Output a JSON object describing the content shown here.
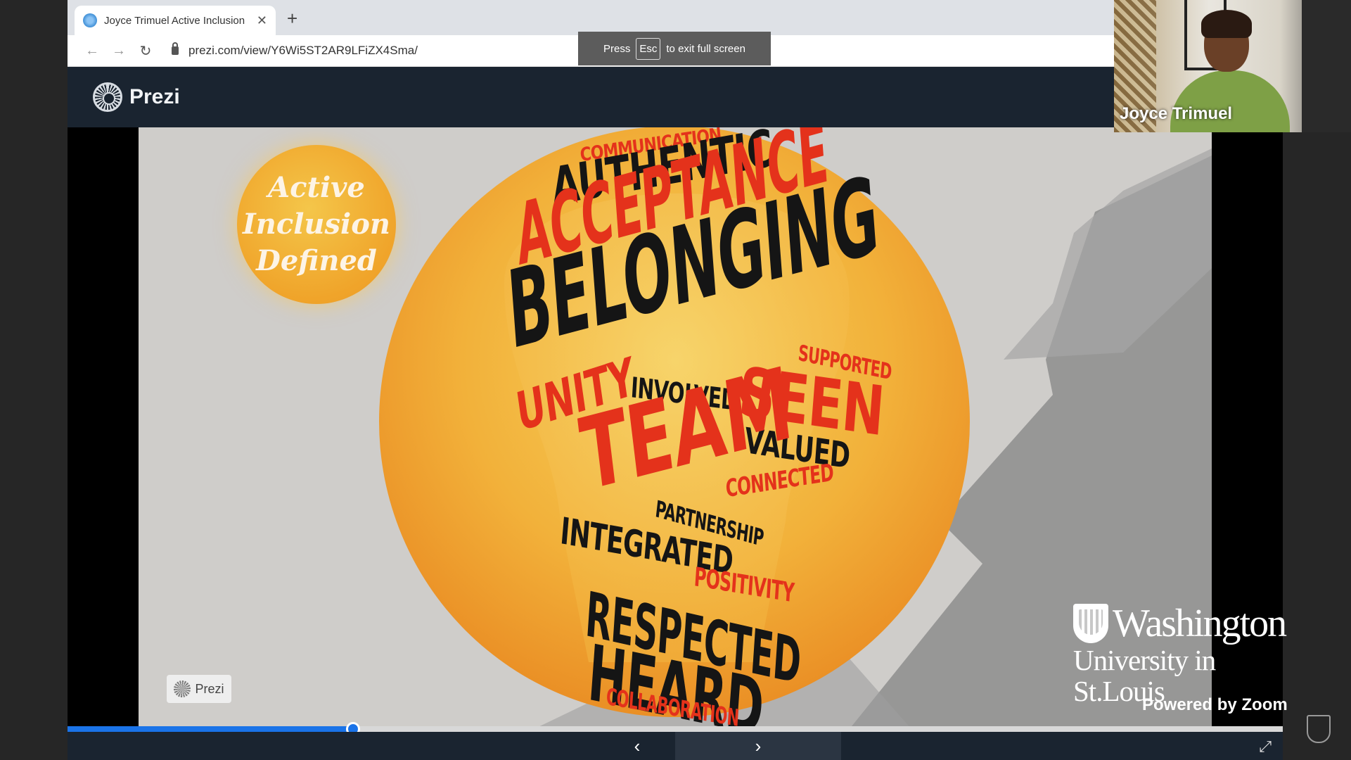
{
  "browser": {
    "tab_title": "Joyce Trimuel Active Inclusion",
    "url": "prezi.com/view/Y6Wi5ST2AR9LFiZX4Sma/"
  },
  "fullscreen_toast": {
    "press": "Press",
    "key": "Esc",
    "message": "to exit full screen"
  },
  "prezi": {
    "brand": "Prezi",
    "watermark": "Prezi"
  },
  "slide": {
    "title_lines": [
      "Active",
      "Inclusion",
      "Defined"
    ],
    "words": {
      "communication": "COMMUNICATION",
      "authentic": "AUTHENTIC",
      "acceptance": "ACCEPTANCE",
      "belonging": "BELONGING",
      "supported": "SUPPORTED",
      "involved": "INVOLVED",
      "seen": "SEEN",
      "unity": "UNITY",
      "valued": "VALUED",
      "team": "TEAM",
      "connected": "CONNECTED",
      "partnership": "PARTNERSHIP",
      "integrated": "INTEGRATED",
      "positivity": "POSITIVITY",
      "respected": "RESPECTED",
      "heard": "HEARD",
      "collaboration": "COLLABORATION"
    },
    "colors": {
      "red": "#e4321b",
      "black": "#151515",
      "orange": "#f0a42a"
    }
  },
  "presentation": {
    "progress_fraction": 0.235
  },
  "zoom": {
    "participant_name": "Joyce Trimuel",
    "powered_by": "Powered by Zoom",
    "logo_line1": "Washington",
    "logo_line2": "University in St.Louis"
  },
  "icons": {
    "back": "arrow-left-icon",
    "forward": "arrow-right-icon",
    "reload": "reload-icon",
    "lock": "lock-icon",
    "prev": "chevron-left-icon",
    "next": "chevron-right-icon",
    "fullscreen": "fullscreen-icon"
  }
}
